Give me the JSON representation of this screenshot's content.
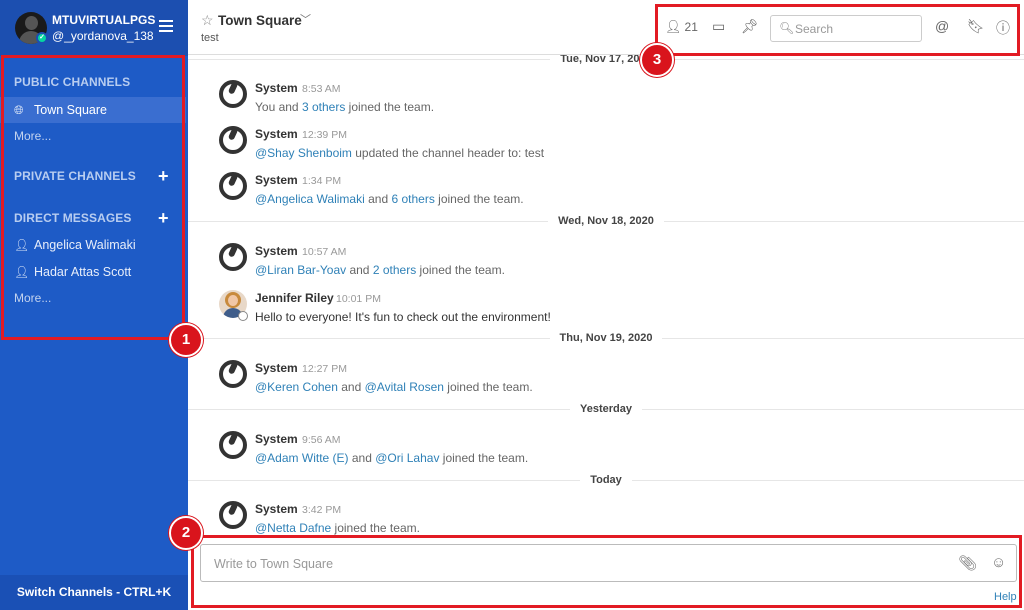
{
  "sidebar": {
    "team_name": "MTUVIRTUALPGS",
    "username": "@_yordanova_138",
    "public_title": "PUBLIC CHANNELS",
    "public_channels": [
      {
        "label": "Town Square"
      }
    ],
    "public_more": "More...",
    "private_title": "PRIVATE CHANNELS",
    "direct_title": "DIRECT MESSAGES",
    "direct_messages": [
      {
        "label": "Angelica Walimaki"
      },
      {
        "label": "Hadar Attas Scott"
      }
    ],
    "direct_more": "More...",
    "switch_label": "Switch Channels - CTRL+K"
  },
  "header": {
    "channel_name": "Town Square",
    "purpose": "test",
    "member_count": "21",
    "search_placeholder": "Search"
  },
  "messages": {
    "dates": [
      "Tue, Nov 17, 2020",
      "Wed, Nov 18, 2020",
      "Thu, Nov 19, 2020",
      "Yesterday",
      "Today"
    ],
    "posts": [
      {
        "author": "System",
        "time": "8:53 AM",
        "pre": "You and ",
        "m1": "3 others",
        "post": " joined the team."
      },
      {
        "author": "System",
        "time": "12:39 PM",
        "m1": "@Shay Shenboim",
        "post": " updated the channel header to: test"
      },
      {
        "author": "System",
        "time": "1:34 PM",
        "m1": "@Angelica Walimaki",
        "mid": " and ",
        "m2": "6 others",
        "post": " joined the team."
      },
      {
        "author": "System",
        "time": "10:57 AM",
        "m1": "@Liran Bar-Yoav",
        "mid": " and ",
        "m2": "2 others",
        "post": " joined the team."
      },
      {
        "author": "Jennifer Riley",
        "time": "10:01 PM",
        "text": "Hello to everyone! It's fun to check out the environment!"
      },
      {
        "author": "System",
        "time": "12:27 PM",
        "m1": "@Keren Cohen",
        "mid": " and ",
        "m2": "@Avital Rosen",
        "post": " joined the team."
      },
      {
        "author": "System",
        "time": "9:56 AM",
        "m1": "@Adam Witte (E)",
        "mid": " and ",
        "m2": "@Ori Lahav",
        "post": " joined the team."
      },
      {
        "author": "System",
        "time": "3:42 PM",
        "m1": "@Netta Dafne",
        "post": " joined the team."
      }
    ]
  },
  "composer": {
    "placeholder": "Write to Town Square",
    "help": "Help"
  },
  "annotations": [
    "1",
    "2",
    "3"
  ],
  "colors": {
    "sidebar": "#1e5bc6",
    "mention": "#2f81b7",
    "annotation": "#e21b23"
  }
}
